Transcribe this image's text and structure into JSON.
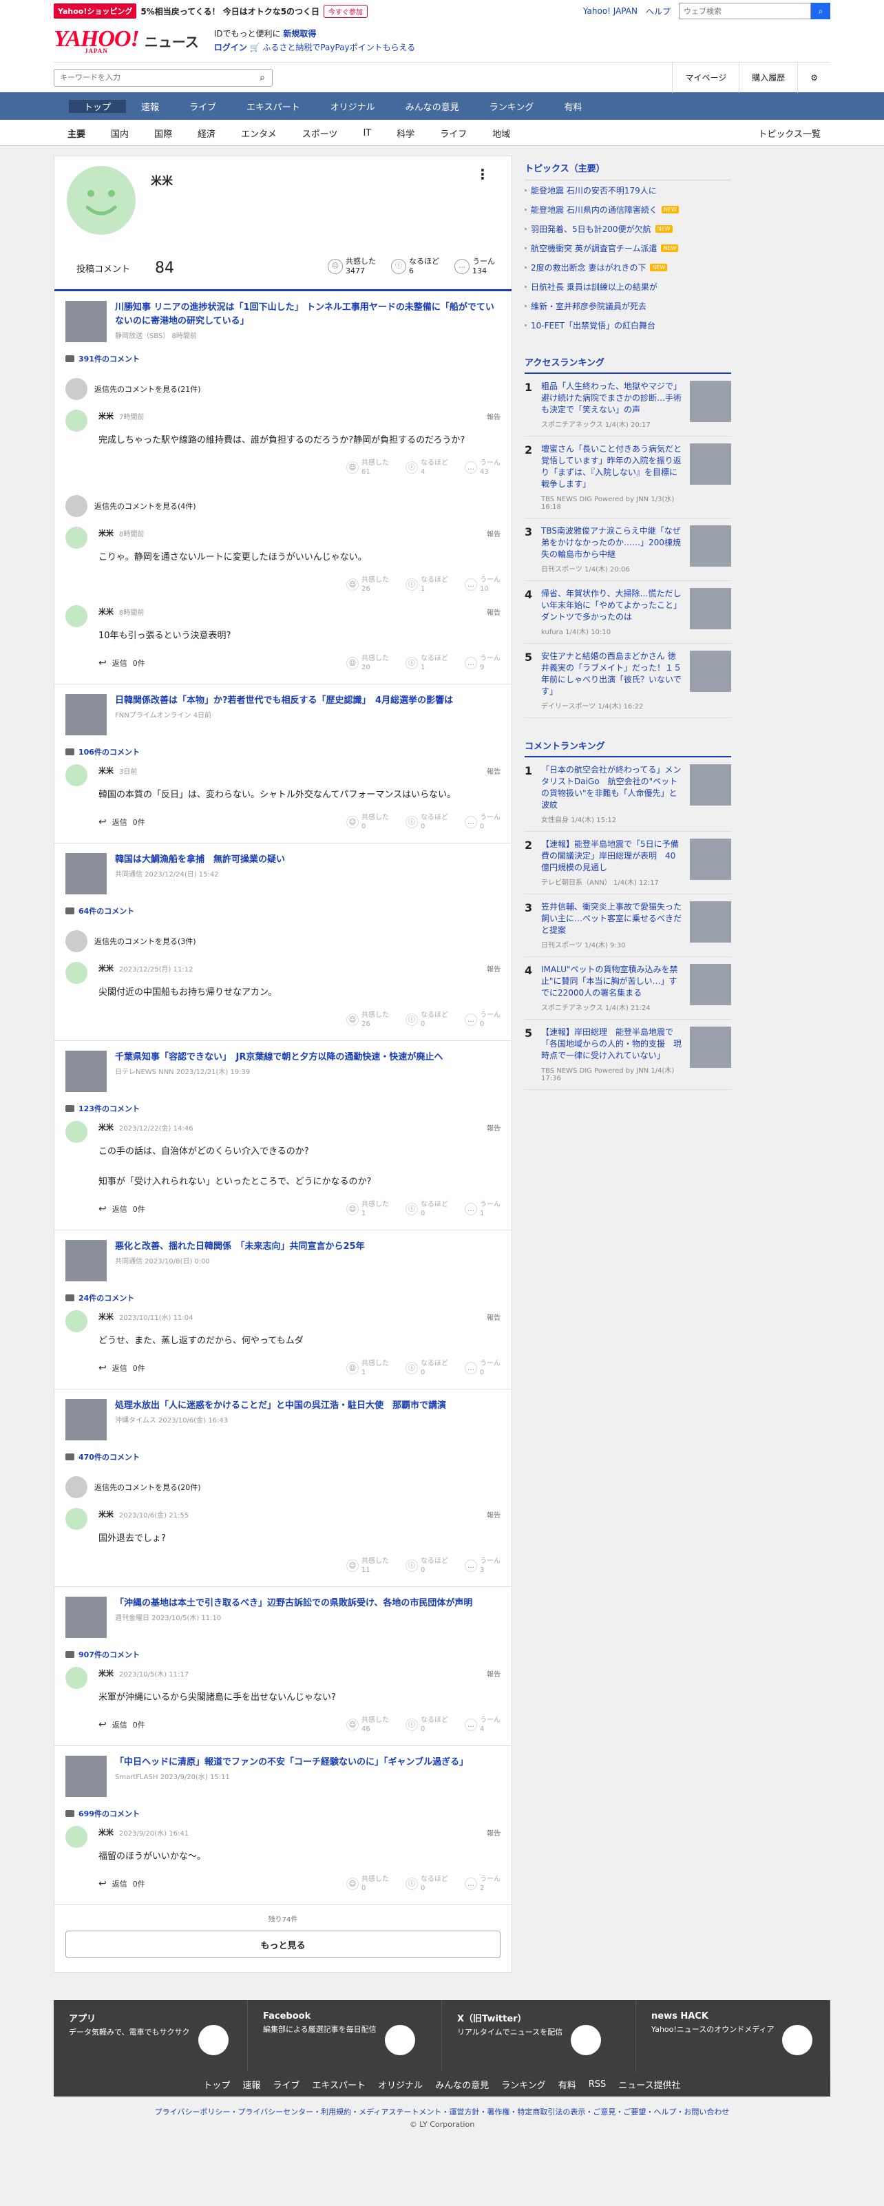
{
  "promo": {
    "badge": "Yahoo!ショッピング",
    "text": "5%相当戻ってくる！ 今日はオトクな5のつく日",
    "btn": "今すぐ参加"
  },
  "toplinks": {
    "yj": "Yahoo! JAPAN",
    "help": "ヘルプ",
    "search_ph": "ウェブ検索"
  },
  "brand": {
    "logo": "YAHOO!",
    "logo_sub": "JAPAN",
    "news": "ニュース",
    "line1a": "IDでもっと便利に",
    "line1b": "新規取得",
    "line2a": "ログイン",
    "line2b": "🛒 ふるさと納税でPayPayポイントもらえる"
  },
  "search": {
    "ph": "キーワードを入力",
    "mypage": "マイページ",
    "buy": "購入履歴"
  },
  "gnav": [
    "トップ",
    "速報",
    "ライブ",
    "エキスパート",
    "オリジナル",
    "みんなの意見",
    "ランキング",
    "有料"
  ],
  "subnav": [
    "主要",
    "国内",
    "国際",
    "経済",
    "エンタメ",
    "スポーツ",
    "IT",
    "科学",
    "ライフ",
    "地域"
  ],
  "subnav_all": "トピックス一覧",
  "profile": {
    "name": "米米",
    "count_label": "投稿コメント",
    "count": "84",
    "r1": "共感した",
    "r1v": "3477",
    "r2": "なるほど",
    "r2v": "6",
    "r3": "うーん",
    "r3v": "134"
  },
  "labels": {
    "report": "報告",
    "reply": "返信",
    "empathy": "共感した",
    "naruhodo": "なるほど",
    "uun": "うーん"
  },
  "articles": [
    {
      "title": "川勝知事 リニアの進捗状況は「1回下山した」 トンネル工事用ヤードの未整備に「船がでていないのに寄港地の研究している」",
      "meta": "静岡放送（SBS） 8時間前",
      "count": "391件のコメント",
      "parents": [
        "返信先のコメントを見る(21件)",
        "返信先のコメントを見る(4件)"
      ],
      "comments": [
        {
          "time": "7時間前",
          "text": "完成しちゃった駅や線路の維持費は、誰が負担するのだろうか?静岡が負担するのだろうか?",
          "e": "61",
          "n": "4",
          "u": "43",
          "reply": ""
        },
        {
          "time": "8時間前",
          "text": "こりゃ。静岡を通さないルートに変更したほうがいいんじゃない。",
          "e": "26",
          "n": "1",
          "u": "10",
          "reply": ""
        },
        {
          "time": "8時間前",
          "text": "10年も引っ張るという決意表明?",
          "e": "20",
          "n": "1",
          "u": "9",
          "reply": "0件"
        }
      ]
    },
    {
      "title": "日韓関係改善は「本物」か?若者世代でも相反する「歴史認識」　4月総選挙の影響は",
      "meta": "FNNプライムオンライン 4日前",
      "count": "106件のコメント",
      "parents": [],
      "comments": [
        {
          "time": "3日前",
          "text": "韓国の本質の「反日」は、変わらない。シャトル外交なんてパフォーマンスはいらない。",
          "e": "0",
          "n": "0",
          "u": "0",
          "reply": "0件"
        }
      ]
    },
    {
      "title": "韓国は大鯛漁船を拿捕　無許可操業の疑い",
      "meta": "共同通信 2023/12/24(日) 15:42",
      "count": "64件のコメント",
      "parents": [
        "返信先のコメントを見る(3件)"
      ],
      "comments": [
        {
          "time": "2023/12/25(月) 11:12",
          "text": "尖閣付近の中国船もお持ち帰りせなアカン。",
          "e": "26",
          "n": "0",
          "u": "0",
          "reply": ""
        }
      ]
    },
    {
      "title": "千葉県知事「容認できない」　JR京葉線で朝と夕方以降の通勤快速・快速が廃止へ",
      "meta": "日テレNEWS NNN 2023/12/21(木) 19:39",
      "count": "123件のコメント",
      "parents": [],
      "comments": [
        {
          "time": "2023/12/22(金) 14:46",
          "text": "この手の話は、自治体がどのくらい介入できるのか?\n\n知事が「受け入れられない」といったところで、どうにかなるのか?",
          "e": "1",
          "n": "0",
          "u": "1",
          "reply": "0件"
        }
      ]
    },
    {
      "title": "悪化と改善、揺れた日韓関係　「未来志向」共同宣言から25年",
      "meta": "共同通信 2023/10/8(日) 0:00",
      "count": "24件のコメント",
      "parents": [],
      "comments": [
        {
          "time": "2023/10/11(水) 11:04",
          "text": "どうせ、また、蒸し返すのだから、何やってもムダ",
          "e": "1",
          "n": "0",
          "u": "0",
          "reply": "0件"
        }
      ]
    },
    {
      "title": "処理水放出「人に迷惑をかけることだ」と中国の呉江浩・駐日大使　那覇市で講演",
      "meta": "沖縄タイムス 2023/10/6(金) 16:43",
      "count": "470件のコメント",
      "parents": [
        "返信先のコメントを見る(20件)"
      ],
      "comments": [
        {
          "time": "2023/10/6(金) 21:55",
          "text": "国外退去でしょ?",
          "e": "11",
          "n": "0",
          "u": "3",
          "reply": ""
        }
      ]
    },
    {
      "title": "「沖縄の基地は本土で引き取るべき」辺野古訴訟での県敗訴受け、各地の市民団体が声明",
      "meta": "週刊金曜日 2023/10/5(木) 11:10",
      "count": "907件のコメント",
      "parents": [],
      "comments": [
        {
          "time": "2023/10/5(木) 11:17",
          "text": "米軍が沖縄にいるから尖閣諸島に手を出せないんじゃない?",
          "e": "46",
          "n": "0",
          "u": "4",
          "reply": "0件"
        }
      ]
    },
    {
      "title": "「中日ヘッドに清原」報道でファンの不安「コーチ経験ないのに」「ギャンブル過ぎる」",
      "meta": "SmartFLASH 2023/9/20(水) 15:11",
      "count": "699件のコメント",
      "parents": [],
      "comments": [
        {
          "time": "2023/9/20(水) 16:41",
          "text": "福留のほうがいいかな〜。",
          "e": "0",
          "n": "0",
          "u": "2",
          "reply": "0件"
        }
      ]
    }
  ],
  "more": {
    "remain": "残り74件",
    "btn": "もっと見る"
  },
  "topics": {
    "title": "トピックス（主要）",
    "items": [
      {
        "t": "能登地震 石川の安否不明179人に",
        "n": ""
      },
      {
        "t": "能登地震 石川県内の通信障害続く",
        "n": "NEW"
      },
      {
        "t": "羽田発着、5日も計200便が欠航",
        "n": "NEW"
      },
      {
        "t": "航空機衝突 英が調査官チーム派遣",
        "n": "NEW"
      },
      {
        "t": "2度の救出断念 妻はがれきの下",
        "n": "NEW"
      },
      {
        "t": "日航社長 乗員は訓練以上の結果が",
        "n": ""
      },
      {
        "t": "維新・室井邦彦参院議員が死去",
        "n": ""
      },
      {
        "t": "10-FEET「出禁覚悟」の紅白舞台",
        "n": ""
      }
    ]
  },
  "access": {
    "title": "アクセスランキング",
    "items": [
      {
        "n": "1",
        "t": "粗品「人生終わった、地獄やマジで」避け続けた病院でまさかの診断…手術も決定で「笑えない」の声",
        "m": "スポニチアネックス 1/4(木) 20:17"
      },
      {
        "n": "2",
        "t": "壇蜜さん「長いこと付きあう病気だと覚悟しています」昨年の入院を振り返り「まずは、『入院しない』を目標に戦争します」",
        "m": "TBS NEWS DIG Powered by JNN 1/3(水) 16:18"
      },
      {
        "n": "3",
        "t": "TBS南波雅俊アナ涙こらえ中継「なぜ弟をかけなかったのか……」200棟焼失の輪島市から中継",
        "m": "日刊スポーツ 1/4(木) 20:06"
      },
      {
        "n": "4",
        "t": "帰省、年賀状作り、大掃除…慌ただしい年末年始に「やめてよかったこと」ダントツで多かったのは",
        "m": "kufura 1/4(木) 10:10"
      },
      {
        "n": "5",
        "t": "安住アナと結婚の西島まどかさん 徳井義実の「ラブメイト」だった！１５年前にしゃべり出演「彼氏？いないです」",
        "m": "デイリースポーツ 1/4(木) 16:22"
      }
    ]
  },
  "crank": {
    "title": "コメントランキング",
    "items": [
      {
        "n": "1",
        "t": "「日本の航空会社が終わってる」メンタリストDaiGo　航空会社の\"ペットの貨物扱い\"を非難も「人命優先」と波紋",
        "m": "女性自身 1/4(木) 15:12"
      },
      {
        "n": "2",
        "t": "【速報】能登半島地震で「5日に予備費の閣議決定」岸田総理が表明　40億円規模の見通し",
        "m": "テレビ朝日系（ANN） 1/4(木) 12:17"
      },
      {
        "n": "3",
        "t": "笠井信輔、衝突炎上事故で愛猫失った飼い主に…ペット客室に乗せるべきだと提案",
        "m": "日刊スポーツ 1/4(木) 9:30"
      },
      {
        "n": "4",
        "t": "IMALU\"ペットの貨物室積み込みを禁止\"に賛同「本当に胸が苦しい…」すでに22000人の署名集まる",
        "m": "スポニチアネックス 1/4(木) 21:24"
      },
      {
        "n": "5",
        "t": "【速報】岸田総理　能登半島地震で「各国地域からの人的・物的支援　現時点で一律に受け入れていない」",
        "m": "TBS NEWS DIG Powered by JNN 1/4(木) 17:36"
      }
    ]
  },
  "footer": {
    "s": [
      {
        "t": "アプリ",
        "d": "データ気軽みで、電車でもサクサク",
        "i": "Y"
      },
      {
        "t": "Facebook",
        "d": "編集部による厳選記事を毎日配信",
        "i": "f"
      },
      {
        "t": "X（旧Twitter）",
        "d": "リアルタイムでニュースを配信",
        "i": "X"
      },
      {
        "t": "news HACK",
        "d": "Yahoo!ニュースのオウンドメディア",
        "i": "HACK"
      }
    ],
    "links": [
      "トップ",
      "速報",
      "ライブ",
      "エキスパート",
      "オリジナル",
      "みんなの意見",
      "ランキング",
      "有料",
      "RSS",
      "ニュース提供社"
    ],
    "legal": "プライバシーポリシー・プライバシーセンター・利用規約・メディアステートメント・運営方針・著作権・特定商取引法の表示・ご意見・ご要望・ヘルプ・お問い合わせ",
    "copy": "© LY Corporation"
  },
  "colors": {
    "accent": "#1a3fb5",
    "gnav": "#44699c",
    "red": "#ff0033"
  }
}
